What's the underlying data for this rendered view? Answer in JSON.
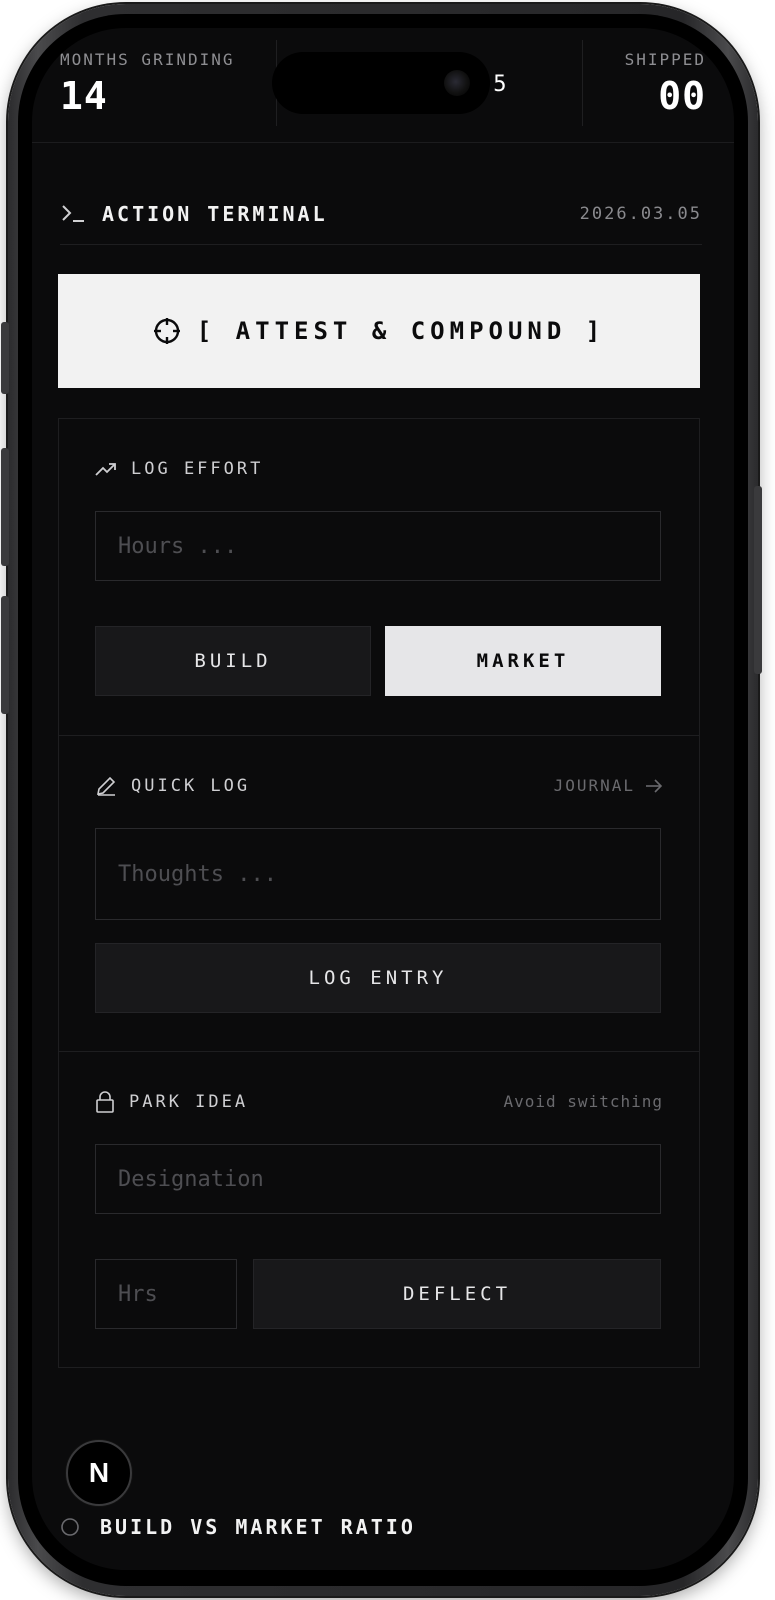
{
  "stats": {
    "left_label": "MONTHS GRINDING",
    "left_value": "14",
    "middle_value": ".5",
    "right_label": "SHIPPED",
    "right_value": "00"
  },
  "header": {
    "prompt_icon": "terminal-prompt-icon",
    "title": "ACTION TERMINAL",
    "date": "2026.03.05"
  },
  "cta": {
    "icon": "crosshair-icon",
    "label": "[ ATTEST & COMPOUND ]"
  },
  "log_effort": {
    "icon": "trending-up-icon",
    "title": "LOG EFFORT",
    "hours_placeholder": "Hours ...",
    "build_label": "BUILD",
    "market_label": "MARKET",
    "selected": "MARKET"
  },
  "quick_log": {
    "icon": "pencil-icon",
    "title": "QUICK LOG",
    "journal_link": "JOURNAL",
    "journal_icon": "arrow-right-icon",
    "thoughts_placeholder": "Thoughts ...",
    "submit_label": "LOG ENTRY"
  },
  "park_idea": {
    "icon": "lock-icon",
    "title": "PARK IDEA",
    "note": "Avoid switching",
    "designation_placeholder": "Designation",
    "hrs_placeholder": "Hrs",
    "deflect_label": "DEFLECT"
  },
  "footer": {
    "section_title": "BUILD VS MARKET RATIO",
    "badge_letter": "N"
  },
  "colors": {
    "background": "#0b0b0c",
    "primary_text": "#f2f2f2",
    "muted_text": "#8a8a8e",
    "accent_light": "#e6e6e8"
  }
}
